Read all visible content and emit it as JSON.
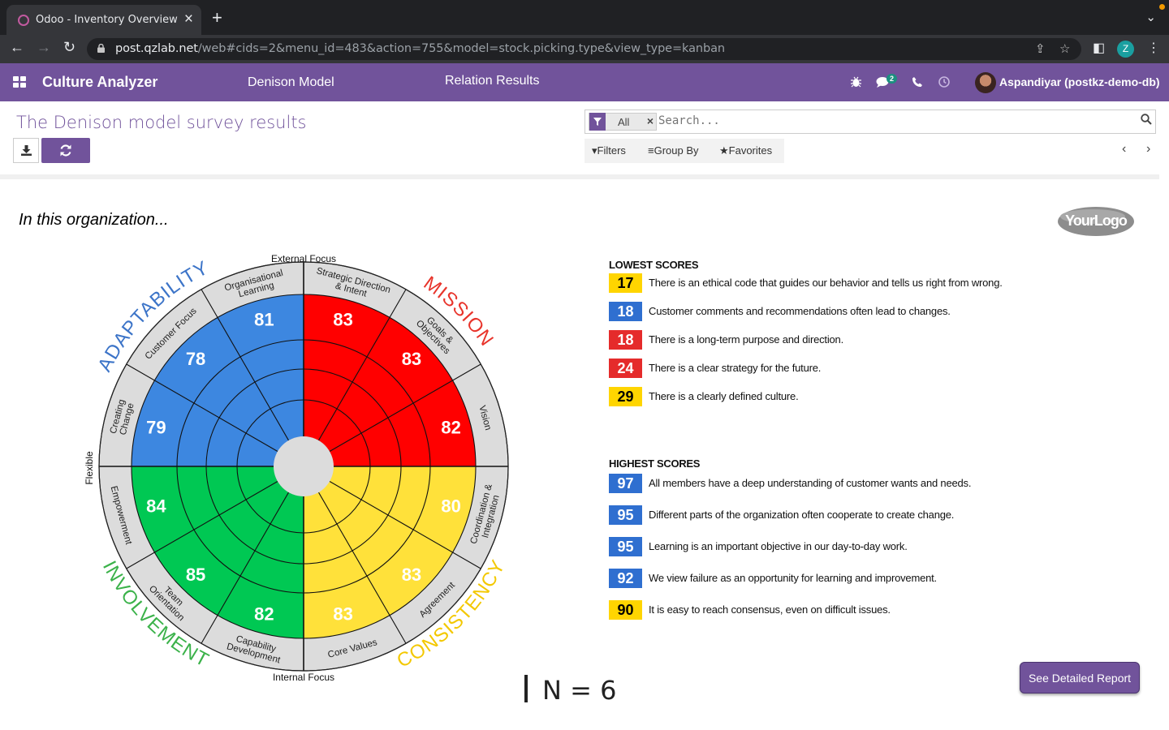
{
  "browser": {
    "tab_title": "Odoo - Inventory Overview",
    "url_host": "post.qzlab.net",
    "url_path": "/web#cids=2&menu_id=483&action=755&model=stock.picking.type&view_type=kanban",
    "profile_initial": "Z"
  },
  "navbar": {
    "app_name": "Culture Analyzer",
    "menu": [
      "Denison Model",
      "Relation Results"
    ],
    "message_count": "2",
    "user": "Aspandiyar (postkz-demo-db)"
  },
  "control_panel": {
    "title": "The Denison model survey results",
    "facet": "All",
    "search_placeholder": "Search...",
    "filters": "Filters",
    "group_by": "Group By",
    "favorites": "Favorites"
  },
  "report": {
    "intro": "In this organization...",
    "logo_text": "YourLogo",
    "n_label": "N = 6",
    "detail_button": "See Detailed Report"
  },
  "chart_data": {
    "type": "polar",
    "axes": {
      "top": "External Focus",
      "bottom": "Internal Focus",
      "left": "Flexible"
    },
    "traits": [
      {
        "name": "MISSION",
        "color": "#ff0000",
        "label_color": "#e8342b"
      },
      {
        "name": "CONSISTENCY",
        "color": "#ffe13a",
        "label_color": "#f3c800"
      },
      {
        "name": "INVOLVEMENT",
        "color": "#00c853",
        "label_color": "#3bb24a"
      },
      {
        "name": "ADAPTABILITY",
        "color": "#3d87e0",
        "label_color": "#3c74c8"
      }
    ],
    "segments": [
      {
        "trait": "MISSION",
        "label": "Strategic Direction & Intent",
        "value": 83
      },
      {
        "trait": "MISSION",
        "label": "Goals & Objectives",
        "value": 83
      },
      {
        "trait": "MISSION",
        "label": "Vision",
        "value": 82
      },
      {
        "trait": "CONSISTENCY",
        "label": "Coordination & Integration",
        "value": 80
      },
      {
        "trait": "CONSISTENCY",
        "label": "Agreement",
        "value": 83
      },
      {
        "trait": "CONSISTENCY",
        "label": "Core Values",
        "value": 83
      },
      {
        "trait": "INVOLVEMENT",
        "label": "Capability Development",
        "value": 82
      },
      {
        "trait": "INVOLVEMENT",
        "label": "Team Orientation",
        "value": 85
      },
      {
        "trait": "INVOLVEMENT",
        "label": "Empowerment",
        "value": 84
      },
      {
        "trait": "ADAPTABILITY",
        "label": "Creating Change",
        "value": 79
      },
      {
        "trait": "ADAPTABILITY",
        "label": "Customer Focus",
        "value": 78
      },
      {
        "trait": "ADAPTABILITY",
        "label": "Organisational Learning",
        "value": 81
      }
    ]
  },
  "lowest_scores": {
    "heading": "LOWEST SCORES",
    "items": [
      {
        "score": "17",
        "color": "#ffd500",
        "text": "There is an ethical code that guides our behavior and tells us right from wrong."
      },
      {
        "score": "18",
        "color": "#2f6fd0",
        "text": "Customer comments and recommendations often lead to changes."
      },
      {
        "score": "18",
        "color": "#e52b2b",
        "text": "There is a long-term purpose and direction."
      },
      {
        "score": "24",
        "color": "#e52b2b",
        "text": "There is a clear strategy for the future."
      },
      {
        "score": "29",
        "color": "#ffd500",
        "text": "There is a clearly defined culture."
      }
    ]
  },
  "highest_scores": {
    "heading": "HIGHEST SCORES",
    "items": [
      {
        "score": "97",
        "color": "#2f6fd0",
        "text": "All members have a deep understanding of customer wants and needs."
      },
      {
        "score": "95",
        "color": "#2f6fd0",
        "text": "Different parts of the organization often cooperate to create change."
      },
      {
        "score": "95",
        "color": "#2f6fd0",
        "text": "Learning is an important objective in our day-to-day work."
      },
      {
        "score": "92",
        "color": "#2f6fd0",
        "text": "We view failure as an opportunity for learning and improvement."
      },
      {
        "score": "90",
        "color": "#ffd500",
        "text": "It is easy to reach consensus, even on difficult issues."
      }
    ]
  }
}
